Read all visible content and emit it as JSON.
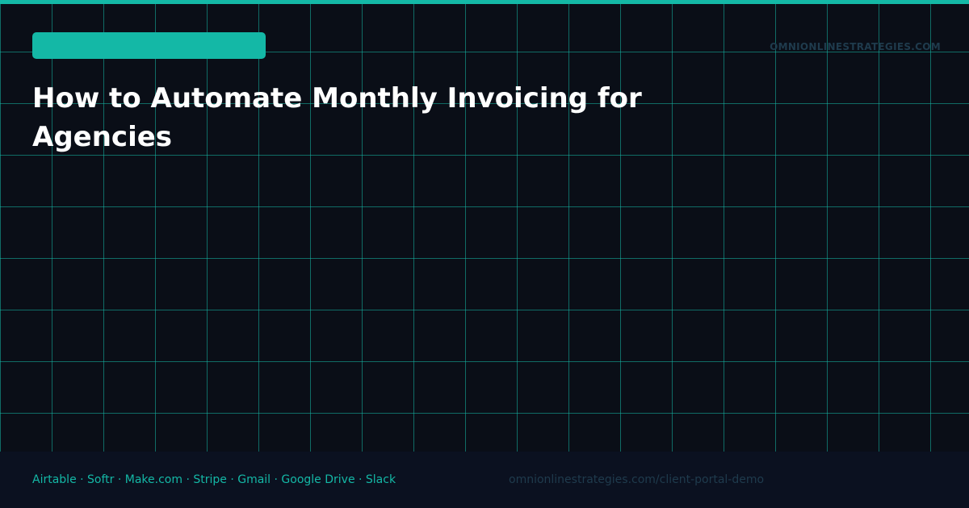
{
  "header": {
    "domain": "OMNIONLINESTRATEGIES.COM",
    "title": "How to Automate Monthly Invoicing for Agencies"
  },
  "footer": {
    "tools": "Airtable · Softr · Make.com · Stripe · Gmail · Google Drive · Slack",
    "url": "omnionlinestrategies.com/client-portal-demo"
  },
  "colors": {
    "accent": "#14b8a6",
    "background": "#0a0e17",
    "footer_background": "#0b1120",
    "muted_text": "#1f3b4d",
    "title_text": "#ffffff"
  }
}
